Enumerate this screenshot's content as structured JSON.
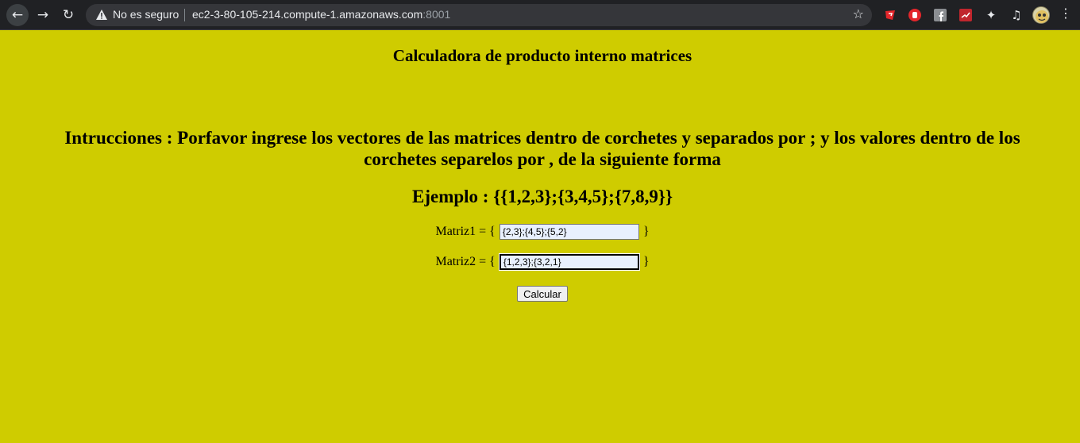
{
  "browser": {
    "security_label": "No es seguro",
    "url_host": "ec2-3-80-105-214.compute-1.amazonaws.com",
    "url_port": ":8001"
  },
  "page": {
    "title": "Calculadora de producto interno matrices",
    "instructions": "Intrucciones : Porfavor ingrese los vectores de las matrices dentro de corchetes y separados por ; y los valores dentro de los corchetes separelos por , de la siguiente forma",
    "example": "Ejemplo : {{1,2,3};{3,4,5};{7,8,9}}",
    "matrix1": {
      "label": "Matriz1 = {",
      "value": "{2,3};{4,5};{5,2}",
      "close": "}"
    },
    "matrix2": {
      "label": "Matriz2 = {",
      "value": "{1,2,3};{3,2,1}",
      "close": "}"
    },
    "button_label": "Calcular"
  },
  "colors": {
    "background": "#cfcc00",
    "toolbar": "#202124",
    "omnibox": "#35363a",
    "input_fill": "#e8f0fe"
  }
}
